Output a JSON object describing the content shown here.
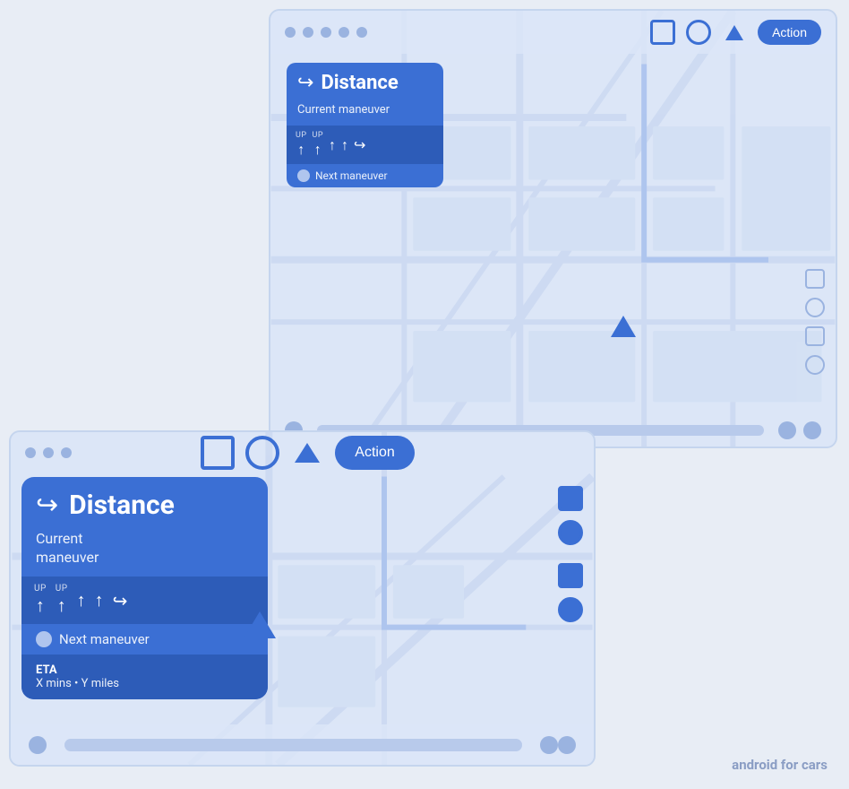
{
  "brand": {
    "text": "android",
    "text2": "for cars"
  },
  "large_screen": {
    "action_button": "Action",
    "nav_widget": {
      "title": "Distance",
      "subtitle": "Current maneuver",
      "lanes": [
        {
          "label": "UP",
          "arrow": "↑"
        },
        {
          "label": "UP",
          "arrow": "↑"
        },
        {
          "label": "",
          "arrow": "↑"
        },
        {
          "label": "",
          "arrow": "↑"
        },
        {
          "label": "",
          "arrow": "↪"
        }
      ],
      "next_maneuver": "Next maneuver"
    }
  },
  "small_screen": {
    "action_button": "Action",
    "nav_widget": {
      "title": "Distance",
      "subtitle": "Current\nmaneuver",
      "lanes": [
        {
          "label": "UP",
          "arrow": "↑"
        },
        {
          "label": "UP",
          "arrow": "↑"
        },
        {
          "label": "",
          "arrow": "↑"
        },
        {
          "label": "",
          "arrow": "↑"
        },
        {
          "label": "",
          "arrow": "↪"
        }
      ],
      "next_maneuver": "Next maneuver",
      "eta_title": "ETA",
      "eta_value": "X mins • Y miles"
    }
  },
  "icons": {
    "square": "▪",
    "circle": "●",
    "triangle": "▲"
  }
}
